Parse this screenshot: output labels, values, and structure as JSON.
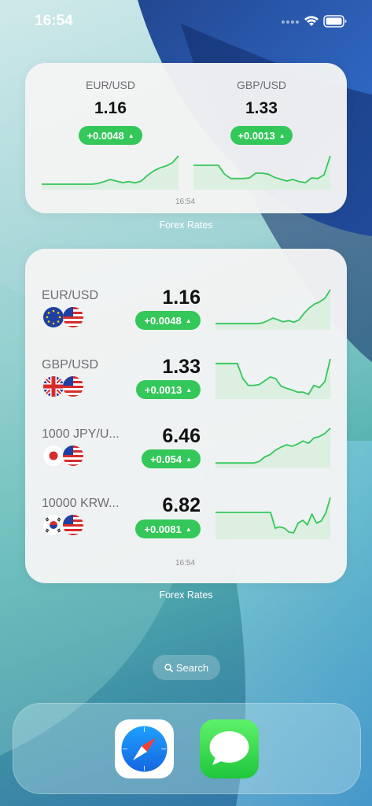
{
  "status_bar": {
    "time": "16:54"
  },
  "widget_small": {
    "items": [
      {
        "pair": "EUR/USD",
        "rate": "1.16",
        "change": "+0.0048",
        "spark": [
          0.1,
          0.1,
          0.1,
          0.1,
          0.1,
          0.1,
          0.1,
          0.1,
          0.1,
          0.12,
          0.18,
          0.25,
          0.2,
          0.15,
          0.18,
          0.14,
          0.2,
          0.38,
          0.52,
          0.62,
          0.68,
          0.78,
          1.0
        ]
      },
      {
        "pair": "GBP/USD",
        "rate": "1.33",
        "change": "+0.0013",
        "spark": [
          0.7,
          0.7,
          0.7,
          0.7,
          0.7,
          0.42,
          0.28,
          0.28,
          0.28,
          0.3,
          0.45,
          0.45,
          0.42,
          0.32,
          0.26,
          0.2,
          0.25,
          0.18,
          0.15,
          0.3,
          0.28,
          0.4,
          1.0
        ]
      }
    ],
    "updated": "16:54",
    "label": "Forex Rates"
  },
  "widget_large": {
    "rows": [
      {
        "pair": "EUR/USD",
        "rate": "1.16",
        "change": "+0.0048",
        "flag_left": "eu",
        "spark": [
          0.1,
          0.1,
          0.1,
          0.1,
          0.1,
          0.1,
          0.1,
          0.1,
          0.1,
          0.12,
          0.18,
          0.25,
          0.2,
          0.15,
          0.18,
          0.14,
          0.2,
          0.38,
          0.52,
          0.62,
          0.68,
          0.78,
          1.0
        ]
      },
      {
        "pair": "GBP/USD",
        "rate": "1.33",
        "change": "+0.0013",
        "flag_left": "uk",
        "spark": [
          0.88,
          0.88,
          0.88,
          0.88,
          0.88,
          0.48,
          0.3,
          0.3,
          0.32,
          0.42,
          0.52,
          0.48,
          0.28,
          0.22,
          0.18,
          0.12,
          0.12,
          0.06,
          0.3,
          0.24,
          0.4,
          1.0
        ]
      },
      {
        "pair": "1000 JPY/U...",
        "rate": "6.46",
        "change": "+0.054",
        "flag_left": "jp",
        "spark": [
          0.08,
          0.08,
          0.08,
          0.08,
          0.08,
          0.08,
          0.08,
          0.08,
          0.12,
          0.24,
          0.3,
          0.42,
          0.5,
          0.56,
          0.52,
          0.58,
          0.66,
          0.6,
          0.74,
          0.78,
          0.86,
          1.0
        ]
      },
      {
        "pair": "10000 KRW...",
        "rate": "6.82",
        "change": "+0.0081",
        "flag_left": "kr",
        "spark": [
          0.62,
          0.62,
          0.62,
          0.62,
          0.62,
          0.62,
          0.62,
          0.62,
          0.62,
          0.62,
          0.62,
          0.62,
          0.62,
          0.22,
          0.25,
          0.22,
          0.12,
          0.1,
          0.35,
          0.42,
          0.3,
          0.58,
          0.35,
          0.4,
          0.6,
          1.0
        ]
      }
    ],
    "updated": "16:54",
    "label": "Forex Rates"
  },
  "search": {
    "label": "Search"
  },
  "dock": {
    "apps": [
      "Safari",
      "Messages"
    ]
  },
  "colors": {
    "accent": "#34c759",
    "spark_fill": "#dcefe1"
  }
}
